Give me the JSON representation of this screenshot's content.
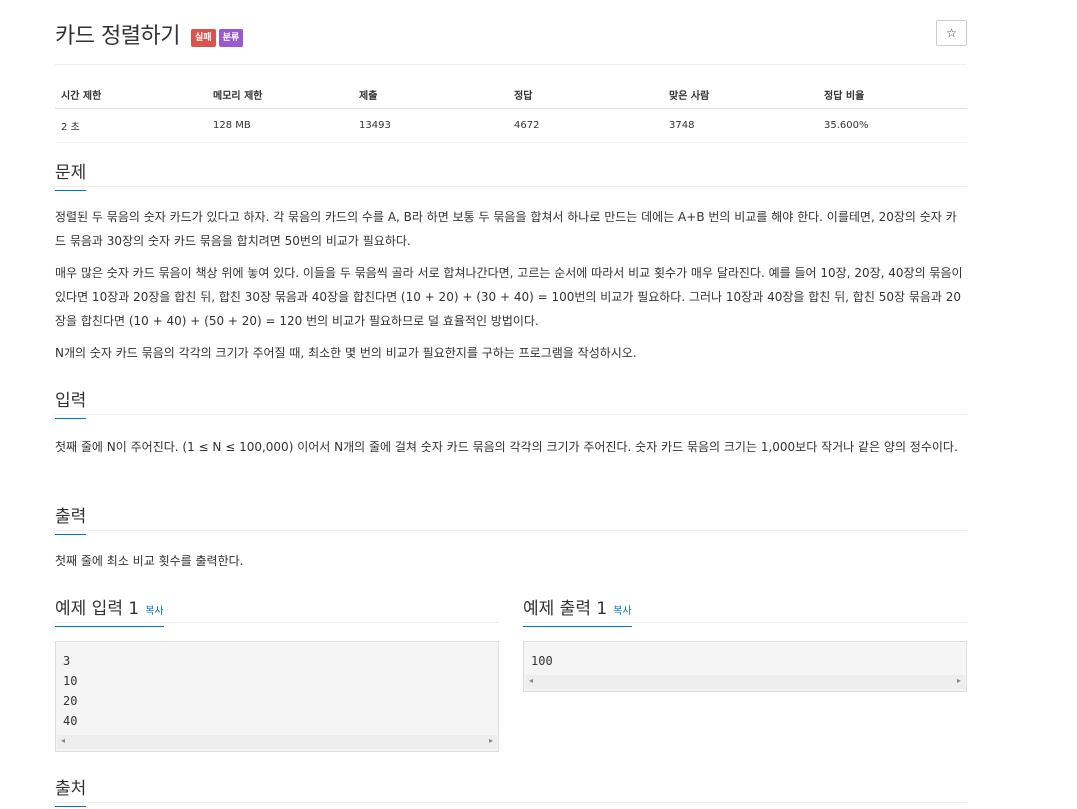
{
  "problem": {
    "title": "카드 정렬하기",
    "badges": [
      "실패",
      "분류"
    ],
    "star": "☆"
  },
  "info_table": {
    "headers": [
      "시간 제한",
      "메모리 제한",
      "제출",
      "정답",
      "맞은 사람",
      "정답 비율"
    ],
    "values": [
      "2 초",
      "128 MB",
      "13493",
      "4672",
      "3748",
      "35.600%"
    ]
  },
  "sections": {
    "description": {
      "heading": "문제",
      "paragraphs": [
        "정렬된 두 묶음의 숫자 카드가 있다고 하자. 각 묶음의 카드의 수를 A, B라 하면 보통 두 묶음을 합쳐서 하나로 만드는 데에는 A+B 번의 비교를 해야 한다. 이를테면, 20장의 숫자 카드 묶음과 30장의 숫자 카드 묶음을 합치려면 50번의 비교가 필요하다.",
        "매우 많은 숫자 카드 묶음이 책상 위에 놓여 있다. 이들을 두 묶음씩 골라 서로 합쳐나간다면, 고르는 순서에 따라서 비교 횟수가 매우 달라진다. 예를 들어 10장, 20장, 40장의 묶음이 있다면 10장과 20장을 합친 뒤, 합친 30장 묶음과 40장을 합친다면 (10 + 20) + (30 + 40) = 100번의 비교가 필요하다. 그러나 10장과 40장을 합친 뒤, 합친 50장 묶음과 20장을 합친다면 (10 + 40) + (50 + 20) = 120 번의 비교가 필요하므로 덜 효율적인 방법이다.",
        "N개의 숫자 카드 묶음의 각각의 크기가 주어질 때, 최소한 몇 번의 비교가 필요한지를 구하는 프로그램을 작성하시오."
      ]
    },
    "input": {
      "heading": "입력",
      "text": "첫째 줄에 N이 주어진다. (1 ≤ N ≤ 100,000) 이어서 N개의 줄에 걸쳐 숫자 카드 묶음의 각각의 크기가 주어진다. 숫자 카드 묶음의 크기는 1,000보다 작거나 같은 양의 정수이다."
    },
    "output": {
      "heading": "출력",
      "text": "첫째 줄에 최소 비교 횟수를 출력한다."
    },
    "source": {
      "heading": "출처"
    }
  },
  "samples": {
    "input": {
      "heading": "예제 입력 1",
      "copy": "복사",
      "content": "3\n10\n20\n40"
    },
    "output": {
      "heading": "예제 출력 1",
      "copy": "복사",
      "content": "100"
    }
  },
  "icons": {
    "scroll_left": "◂",
    "scroll_right": "▸"
  }
}
